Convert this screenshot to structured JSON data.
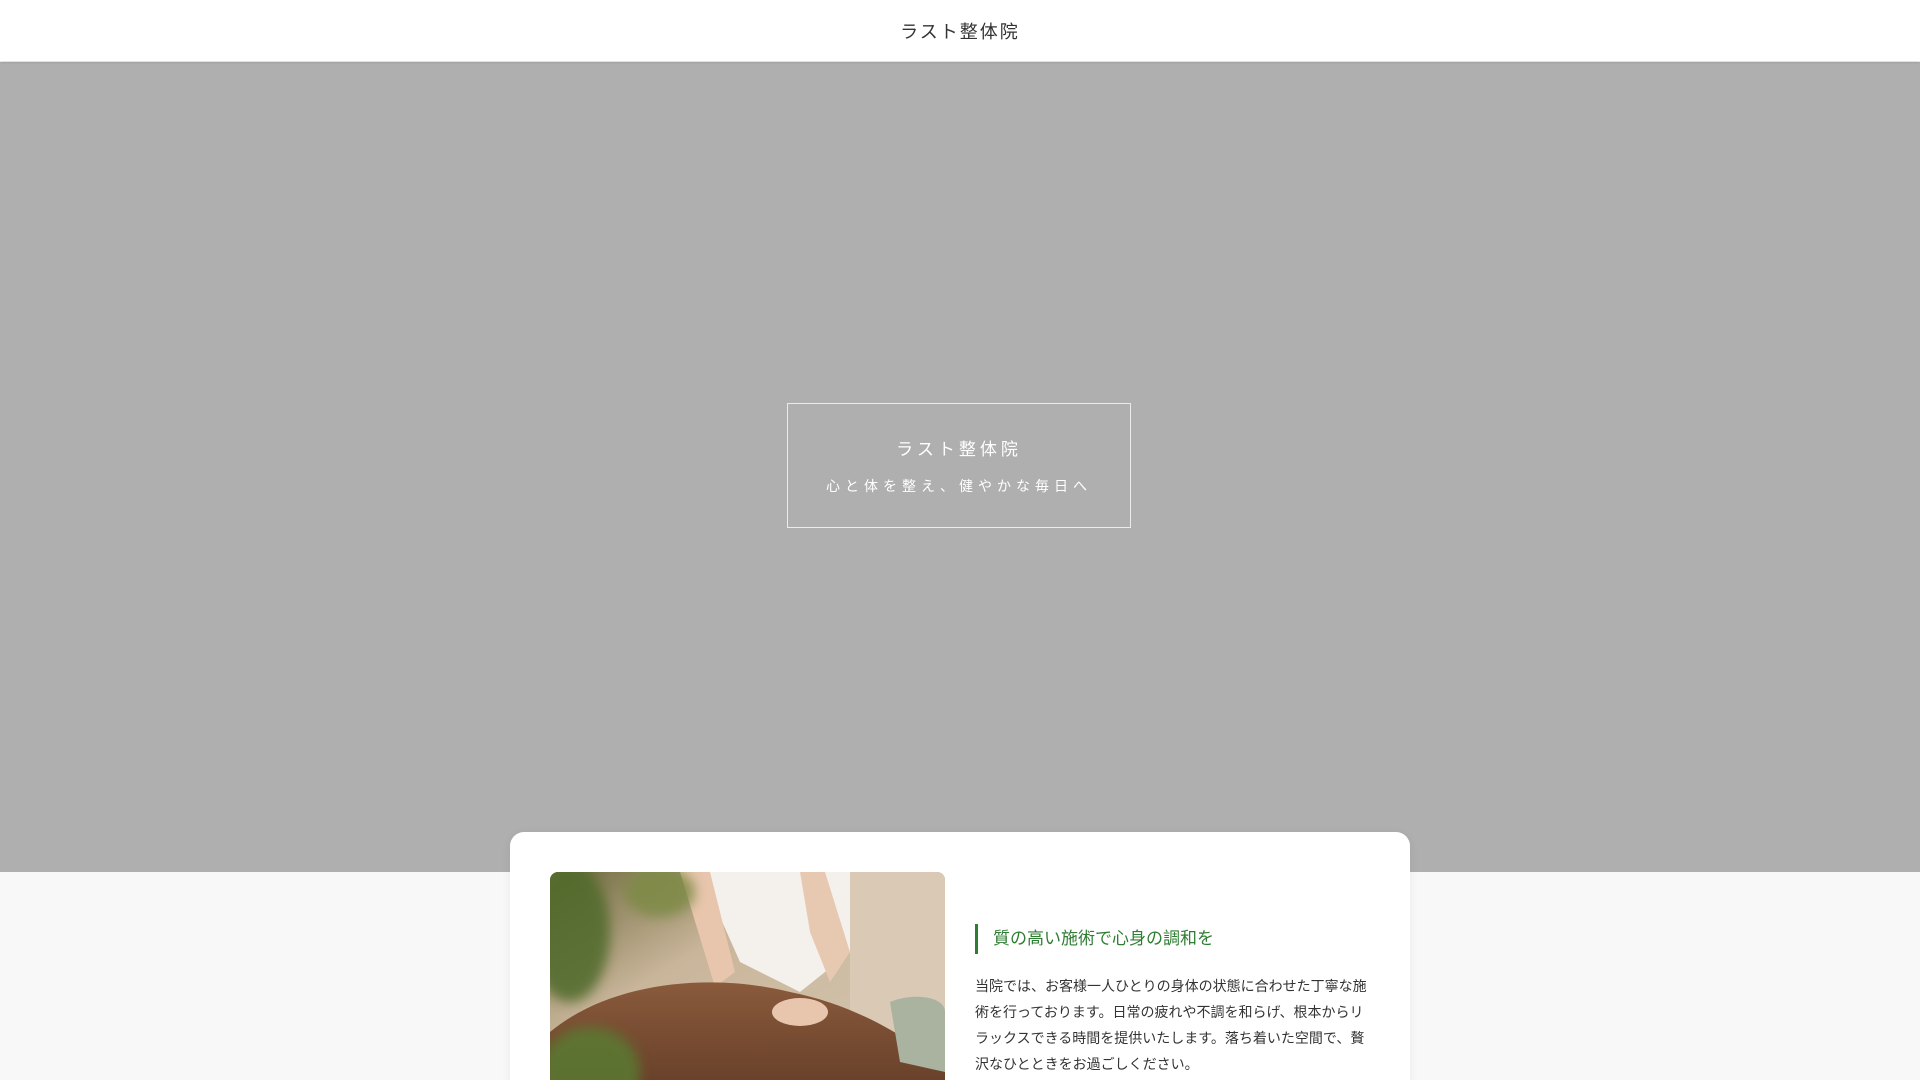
{
  "header": {
    "site_title": "ラスト整体院"
  },
  "hero": {
    "title": "ラスト整体院",
    "subtitle": "心と体を整え、健やかな毎日へ",
    "background_color": "#afafaf"
  },
  "intro": {
    "heading": "質の高い施術で心身の調和を",
    "body": "当院では、お客様一人ひとりの身体の状態に合わせた丁寧な施術を行っております。日常の疲れや不調を和らげ、根本からリラックスできる時間を提供いたします。落ち着いた空間で、贅沢なひとときをお過ごしください。",
    "accent_color": "#2e7d32"
  }
}
